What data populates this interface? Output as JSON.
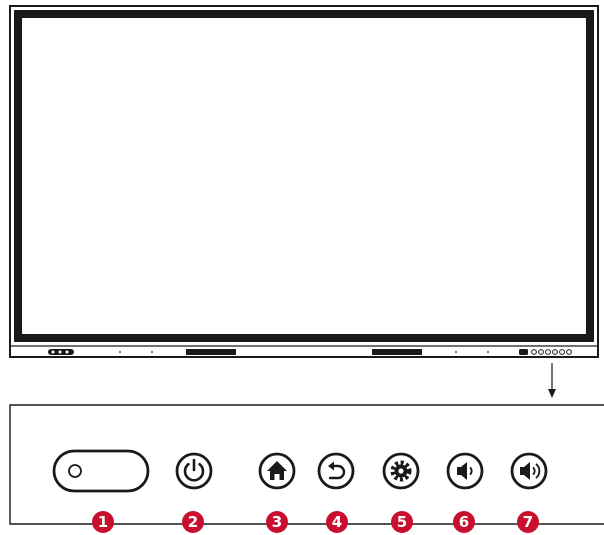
{
  "diagram": {
    "colors": {
      "outline": "#1a1a1a",
      "badge": "#c8102e",
      "badge_text": "#ffffff"
    },
    "panel_buttons": [
      {
        "number": "1",
        "icon": "ir-sensor-icon"
      },
      {
        "number": "2",
        "icon": "power-icon"
      },
      {
        "number": "3",
        "icon": "home-icon"
      },
      {
        "number": "4",
        "icon": "back-icon"
      },
      {
        "number": "5",
        "icon": "settings-gear-icon"
      },
      {
        "number": "6",
        "icon": "volume-down-icon"
      },
      {
        "number": "7",
        "icon": "volume-up-icon"
      }
    ]
  }
}
